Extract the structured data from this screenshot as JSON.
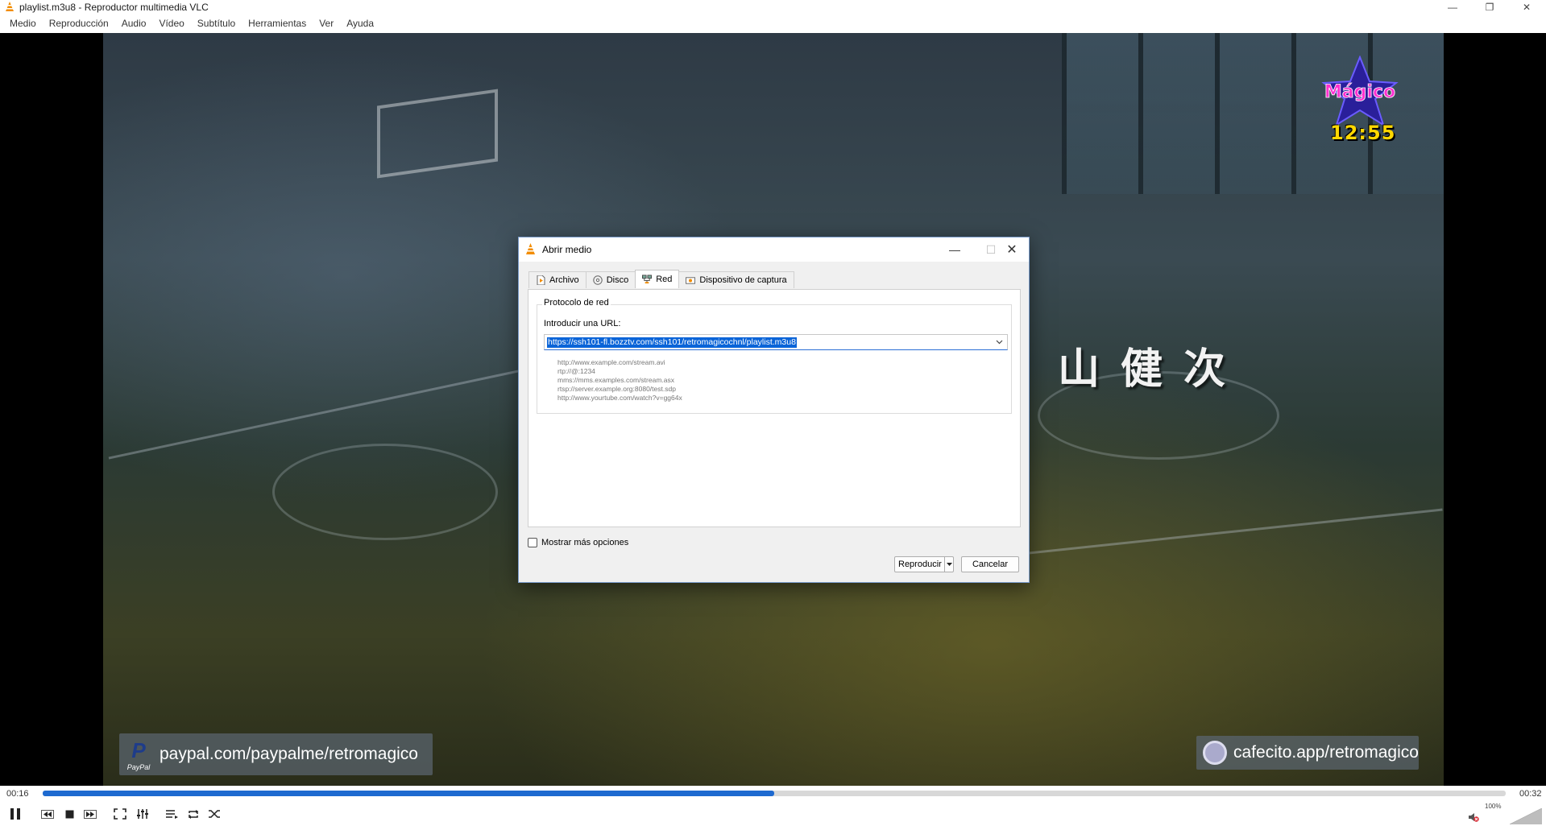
{
  "window": {
    "title": "playlist.m3u8 - Reproductor multimedia VLC",
    "minimize_glyph": "—",
    "maximize_glyph": "❐",
    "close_glyph": "✕"
  },
  "menu": [
    "Medio",
    "Reproducción",
    "Audio",
    "Vídeo",
    "Subtítulo",
    "Herramientas",
    "Ver",
    "Ayuda"
  ],
  "video": {
    "overlay_clock": "12:55",
    "overlay_logo_text": "Mágico",
    "overlay_kanji": "山健次",
    "paypal_banner": "paypal.com/paypalme/retromagico",
    "paypal_mark": "PayPal",
    "cafecito_banner": "cafecito.app/retromagico"
  },
  "dialog": {
    "title": "Abrir medio",
    "tabs": [
      {
        "label": "Archivo",
        "icon": "file-icon",
        "active": false
      },
      {
        "label": "Disco",
        "icon": "disc-icon",
        "active": false
      },
      {
        "label": "Red",
        "icon": "network-icon",
        "active": true
      },
      {
        "label": "Dispositivo de captura",
        "icon": "capture-device-icon",
        "active": false
      }
    ],
    "group_title": "Protocolo de red",
    "url_label": "Introducir una URL:",
    "url_value": "https://ssh101-fl.bozztv.com/ssh101/retromagicochnl/playlist.m3u8",
    "examples": [
      "http://www.example.com/stream.avi",
      "rtp://@:1234",
      "mms://mms.examples.com/stream.asx",
      "rtsp://server.example.org:8080/test.sdp",
      "http://www.yourtube.com/watch?v=gg64x"
    ],
    "more_options_label": "Mostrar más opciones",
    "more_options_checked": false,
    "play_button": "Reproducir",
    "cancel_button": "Cancelar"
  },
  "player": {
    "elapsed": "00:16",
    "total": "00:32",
    "progress_fraction": 0.5,
    "volume_label": "100%",
    "accent_color": "#1e6ad0"
  }
}
